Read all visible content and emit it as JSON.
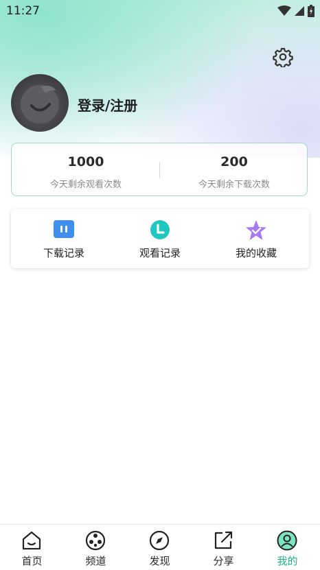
{
  "status_bar": {
    "time": "11:27"
  },
  "profile": {
    "login_label": "登录/注册"
  },
  "stats": [
    {
      "value": "1000",
      "label": "今天剩余观看次数"
    },
    {
      "value": "200",
      "label": "今天剩余下载次数"
    }
  ],
  "quick_actions": [
    {
      "label": "下载记录",
      "icon": "download-record-icon",
      "color": "#3e8ff0"
    },
    {
      "label": "观看记录",
      "icon": "watch-history-icon",
      "color": "#1ec8c0"
    },
    {
      "label": "我的收藏",
      "icon": "favorites-star-icon",
      "color": "#9b6cf0"
    }
  ],
  "bottom_nav": {
    "items": [
      {
        "label": "首页",
        "icon": "home-icon"
      },
      {
        "label": "频道",
        "icon": "film-reel-icon"
      },
      {
        "label": "发现",
        "icon": "compass-icon"
      },
      {
        "label": "分享",
        "icon": "share-icon"
      },
      {
        "label": "我的",
        "icon": "profile-icon",
        "active": true
      }
    ],
    "active_color": "#1eb483"
  }
}
